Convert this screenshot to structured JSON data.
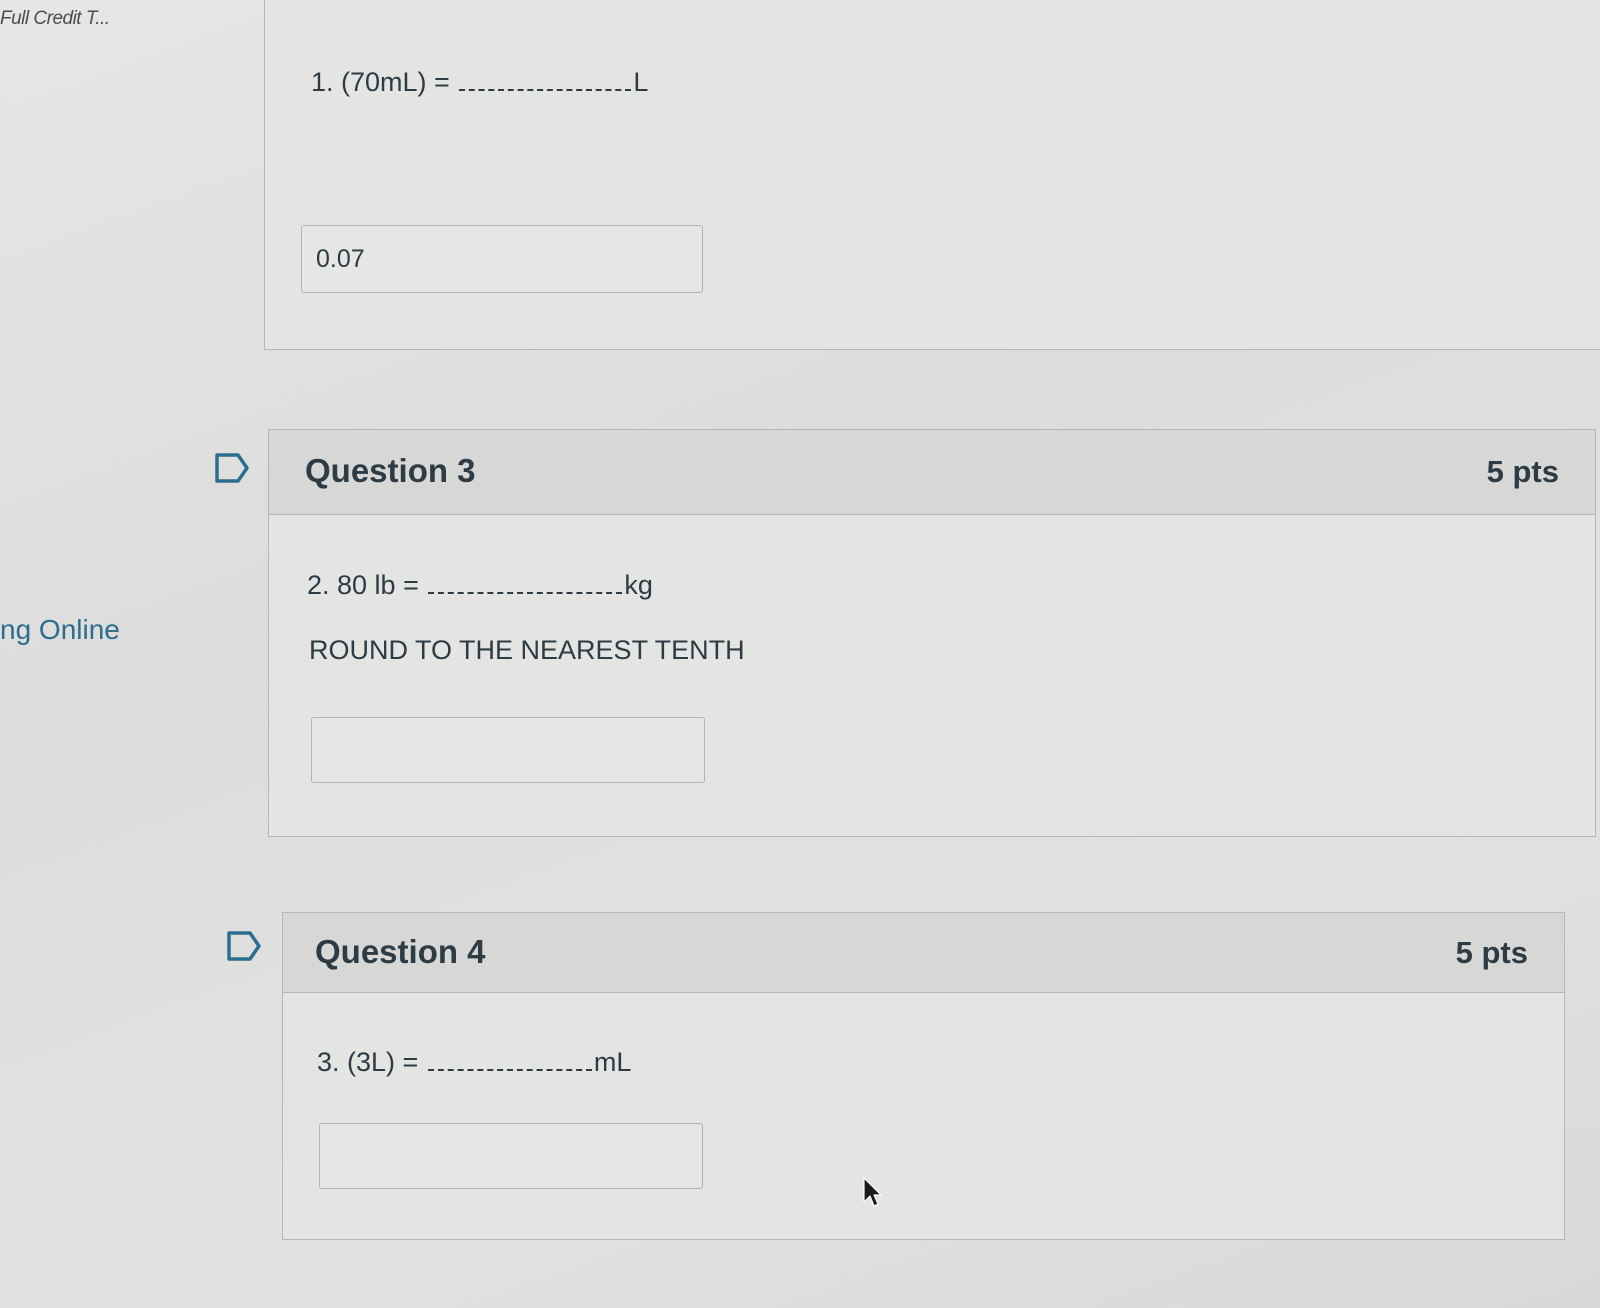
{
  "sidebar": {
    "top_link": "Full Credit T...",
    "mid_label": "ng Online"
  },
  "question_prev": {
    "text_prefix": "1. (70mL) =",
    "unit": "L",
    "answer_value": "0.07"
  },
  "question_3": {
    "title": "Question 3",
    "points": "5 pts",
    "text_prefix": "2.  80 lb =",
    "unit": "kg",
    "instruction": "ROUND TO THE NEAREST TENTH",
    "answer_value": ""
  },
  "question_4": {
    "title": "Question 4",
    "points": "5 pts",
    "text_prefix": "3. (3L) =",
    "unit": "mL",
    "answer_value": ""
  },
  "icons": {
    "flag": "flag-outline-icon",
    "cursor": "mouse-pointer-icon"
  },
  "colors": {
    "text": "#2d3b45",
    "link": "#2b6e8f",
    "flag": "#2b6e8f"
  }
}
